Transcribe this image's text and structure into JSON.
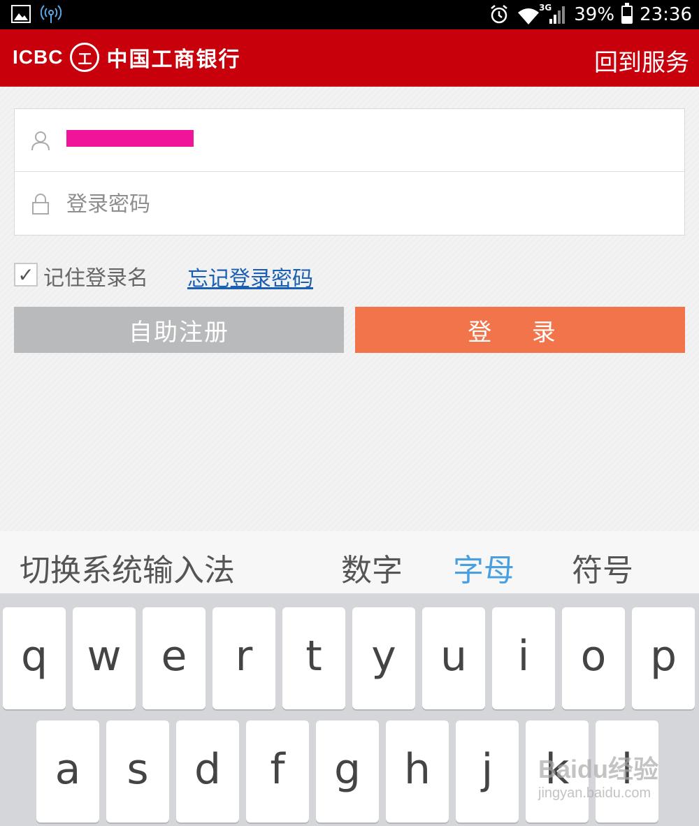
{
  "status_bar": {
    "left_icons": [
      "gallery-icon",
      "signal-broadcast-icon"
    ],
    "network": "3G",
    "battery_percent": "39%",
    "battery_level": 0.39,
    "time": "23:36"
  },
  "header": {
    "brand_en": "ICBC",
    "brand_seal": "工",
    "brand_cn": "中国工商银行",
    "back_link": "回到服务"
  },
  "login": {
    "username_value": "",
    "password_placeholder": "登录密码",
    "remember_checked": true,
    "remember_label": "记住登录名",
    "forgot_link": "忘记登录密码",
    "register_button": "自助注册",
    "login_button": "登 录"
  },
  "keyboard": {
    "modes": {
      "switch": "切换系统输入法",
      "number": "数字",
      "letter": "字母",
      "symbol": "符号"
    },
    "active_mode": "letter",
    "row1": [
      "q",
      "w",
      "e",
      "r",
      "t",
      "y",
      "u",
      "i",
      "o",
      "p"
    ],
    "row2": [
      "a",
      "s",
      "d",
      "f",
      "g",
      "h",
      "j",
      "k",
      "l"
    ]
  },
  "watermark": {
    "main": "Baidu经验",
    "sub": "jingyan.baidu.com"
  }
}
